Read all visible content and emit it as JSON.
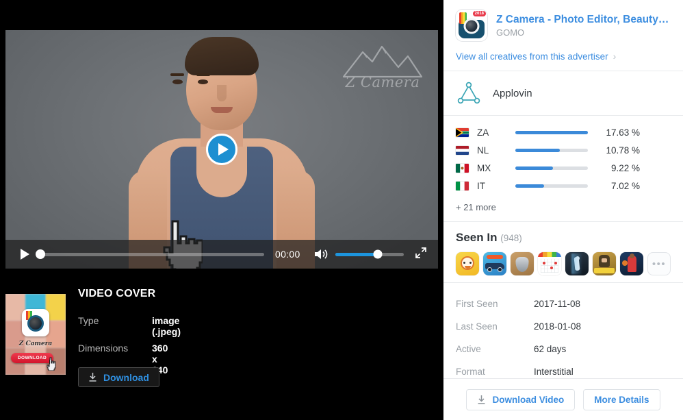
{
  "advertiser": {
    "app_title": "Z Camera - Photo Editor, Beauty…",
    "publisher": "GOMO",
    "icon_badge": "2018",
    "view_all_label": "View all creatives from this advertiser",
    "chevron": "›"
  },
  "network": {
    "name": "Applovin",
    "icon": "applovin-logo-icon"
  },
  "countries": {
    "rows": [
      {
        "code": "ZA",
        "pct": "17.63 %",
        "value": 17.63,
        "flag": "za-flag-icon"
      },
      {
        "code": "NL",
        "pct": "10.78 %",
        "value": 10.78,
        "flag": "nl-flag-icon"
      },
      {
        "code": "MX",
        "pct": "9.22 %",
        "value": 9.22,
        "flag": "mx-flag-icon"
      },
      {
        "code": "IT",
        "pct": "7.02 %",
        "value": 7.02,
        "flag": "it-flag-icon"
      }
    ],
    "more_label": "+ 21 more",
    "bar_color": "#3b8ad9",
    "bar_track_color": "#dcdfe3"
  },
  "seen_in": {
    "heading": "Seen In",
    "count": "(948)",
    "apps": [
      "smiley-game-icon",
      "hot-wheels-car-icon",
      "guitar-pick-icon",
      "bingo-card-icon",
      "walking-figure-icon",
      "soldier-shooter-icon",
      "basketball-player-icon"
    ],
    "more_icon": "•••"
  },
  "details": {
    "rows": [
      {
        "key": "First Seen",
        "value": "2017-11-08"
      },
      {
        "key": "Last Seen",
        "value": "2018-01-08"
      },
      {
        "key": "Active",
        "value": "62 days"
      },
      {
        "key": "Format",
        "value": "Interstitial"
      }
    ]
  },
  "footer": {
    "download_video_label": "Download Video",
    "more_details_label": "More Details"
  },
  "player": {
    "time": "00:00",
    "scrub_percent": 0,
    "volume_percent": 62,
    "play_icon": "play-icon",
    "volume_icon": "volume-icon",
    "fullscreen_icon": "fullscreen-icon",
    "watermark": "Z Camera"
  },
  "cover": {
    "section_title": "VIDEO COVER",
    "type_key": "Type",
    "type_value": "image (.jpeg)",
    "dimensions_key": "Dimensions",
    "dimensions_value": "360 x 640",
    "download_label": "Download",
    "thumb_app_name": "Z Camera",
    "thumb_cta": "DOWNLOAD"
  },
  "colors": {
    "accent_blue": "#3d8ee0",
    "player_blue": "#1d8fd1",
    "panel_bg": "#ffffff",
    "left_bg": "#000000"
  }
}
